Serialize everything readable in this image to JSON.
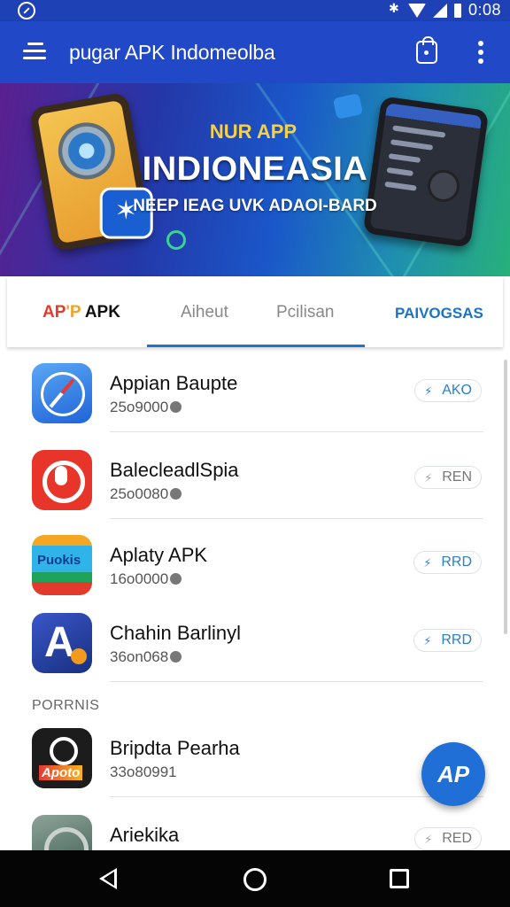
{
  "status_bar": {
    "time": "0:08"
  },
  "app_bar": {
    "title": "pugar APK Indomeolba"
  },
  "banner": {
    "line1": "NUR APP",
    "line2": "INDIONEASIA",
    "line3": "NEEP IEAG UVK ADAOI-BARD"
  },
  "tabs": [
    {
      "label_a": "AP",
      "label_b": "'P",
      "label_c": " APK"
    },
    {
      "label": "Aiheut"
    },
    {
      "label": "Pcilisan"
    },
    {
      "label": "PAIVOGSAS"
    }
  ],
  "apps": [
    {
      "name": "Appian Baupte",
      "sub": "25o9000",
      "action": "AKO",
      "action_style": "blue",
      "icon": "compass-icon"
    },
    {
      "name": "BalecleadlSpia",
      "sub": "25o0080",
      "action": "REN",
      "action_style": "grey",
      "icon": "red-app-icon"
    },
    {
      "name": "Aplaty APK",
      "sub": "16o0000",
      "action": "RRD",
      "action_style": "blue",
      "icon": "puokis-app-icon",
      "icon_text": "Puokis"
    },
    {
      "name": "Chahin Barlinyl",
      "sub": "36on068",
      "action": "RRD",
      "action_style": "blue",
      "icon": "a-letter-app-icon",
      "icon_text": "A"
    },
    {
      "name": "Bripdta Pearha",
      "sub": "33o80991",
      "icon": "apoto-app-icon",
      "icon_text": "Apoto"
    },
    {
      "name": "Ariekika",
      "action": "RED",
      "action_style": "grey",
      "icon": "grey-app-icon"
    }
  ],
  "section_label": "PORRNIS",
  "fab": {
    "label": "AP"
  },
  "colors": {
    "primary": "#2148c7",
    "accent": "#1f73c9",
    "fab": "#1f6fd6"
  }
}
